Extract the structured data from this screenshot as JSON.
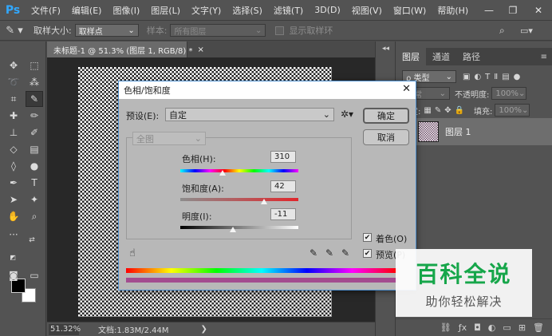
{
  "app": {
    "logo": "Ps",
    "menus": [
      "文件(F)",
      "编辑(E)",
      "图像(I)",
      "图层(L)",
      "文字(Y)",
      "选择(S)",
      "滤镜(T)",
      "3D(D)",
      "视图(V)",
      "窗口(W)",
      "帮助(H)"
    ]
  },
  "options": {
    "sample_size_label": "取样大小:",
    "sample_size_value": "取样点",
    "sample_label": "样本:",
    "sample_value": "所有图层",
    "show_ring_label": "显示取样环"
  },
  "document": {
    "tab_title": "未标题-1 @ 51.3% (图层 1, RGB/8) *",
    "tab_close": "×",
    "zoom": "51.32%",
    "doc_info": "文档:1.83M/2.44M",
    "status_arrow": "❯"
  },
  "layers_panel": {
    "tabs": [
      "图层",
      "通道",
      "路径"
    ],
    "filter_kind": "ρ 类型",
    "blend_mode": "正常",
    "opacity_label": "不透明度:",
    "opacity_value": "100%",
    "lock_label": "锁定:",
    "fill_label": "填充:",
    "fill_value": "100%",
    "layer_name": "图层 1"
  },
  "dialog": {
    "title": "色相/饱和度",
    "close": "✕",
    "preset_label": "预设(E):",
    "preset_value": "自定",
    "channel_value": "全图",
    "ok_label": "确定",
    "cancel_label": "取消",
    "hue_label": "色相(H):",
    "hue_value": "310",
    "saturation_label": "饱和度(A):",
    "saturation_value": "42",
    "lightness_label": "明度(I):",
    "lightness_value": "-11",
    "colorize_label": "着色(O)",
    "preview_label": "预览(P)",
    "colorize_checked": true,
    "preview_checked": true
  },
  "sliders": {
    "hue": {
      "min": -180,
      "max": 180,
      "value": 310
    },
    "saturation": {
      "min": -100,
      "max": 100,
      "value": 42
    },
    "lightness": {
      "min": -100,
      "max": 100,
      "value": -11
    }
  },
  "watermark": {
    "line1": "百科全说",
    "line2": "助你轻松解决"
  }
}
